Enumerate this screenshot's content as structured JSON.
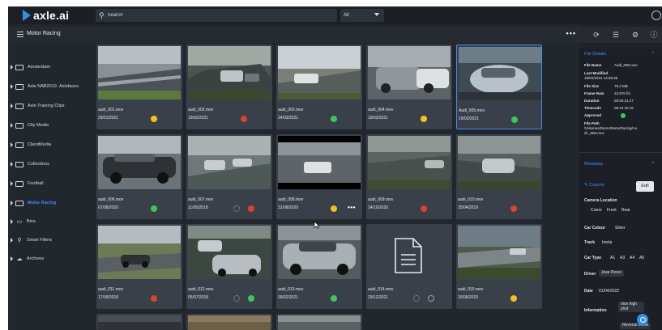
{
  "app": {
    "logo_text": "axle.ai"
  },
  "topbar": {
    "search_placeholder": "Search",
    "filter_value": "All"
  },
  "subbar": {
    "title": "Motor Racing",
    "more": "•••"
  },
  "sidebar": {
    "items": [
      {
        "label": "Amsterdam",
        "type": "folder"
      },
      {
        "label": "Axle NAB2019 -Axlefaces",
        "type": "folder"
      },
      {
        "label": "Axle Training Clips",
        "type": "folder"
      },
      {
        "label": "City Media",
        "type": "folder"
      },
      {
        "label": "ClientMedia",
        "type": "folder"
      },
      {
        "label": "Collections",
        "type": "folder"
      },
      {
        "label": "Football",
        "type": "folder"
      },
      {
        "label": "Motor Racing",
        "type": "folder",
        "active": true
      },
      {
        "label": "Bins",
        "type": "bins"
      },
      {
        "label": "Smart Filters",
        "type": "filters"
      },
      {
        "label": "Archives",
        "type": "archives"
      }
    ]
  },
  "colors": {
    "yellow": "#f2c21b",
    "red": "#d9432f",
    "green": "#3cc65a",
    "accent": "#3b8ff0"
  },
  "grid": {
    "cards": [
      {
        "name": "audi_001.mov",
        "date": "29/01/2021",
        "status": "yellow"
      },
      {
        "name": "audi_002.mov",
        "date": "19/02/2021",
        "status": "red"
      },
      {
        "name": "audi_003.mov",
        "date": "24/03/2021",
        "status": "green"
      },
      {
        "name": "audi_004.mov",
        "date": "19/02/2021",
        "status": "yellow"
      },
      {
        "name": "Audi_005.mov",
        "date": "19/02/2021",
        "status": "green",
        "selected": true
      },
      {
        "name": "audi_006.mov",
        "date": "07/08/2020",
        "status": "green"
      },
      {
        "name": "audi_007.mov",
        "date": "11/05/2018",
        "status": "red",
        "pending": true
      },
      {
        "name": "audi_008.mov",
        "date": "31/08/2020",
        "status": "yellow",
        "more": "•••"
      },
      {
        "name": "audi_009.mov",
        "date": "14/10/2020",
        "status": "red"
      },
      {
        "name": "audi_010.mov",
        "date": "25/04/2019",
        "status": "red"
      },
      {
        "name": "audi_011.mov",
        "date": "17/09/2018",
        "status": "red"
      },
      {
        "name": "audi_012.mov",
        "date": "05/07/2018",
        "status": "green",
        "pending": true
      },
      {
        "name": "audi_013.mov",
        "date": "09/02/2021",
        "status": "green"
      },
      {
        "name": "audi_014.mov",
        "date": "29/12/2021",
        "status": "none",
        "pending": true,
        "document": true
      },
      {
        "name": "audi_015.mov",
        "date": "16/06/2020",
        "status": "yellow"
      }
    ]
  },
  "file_details": {
    "heading": "File Details",
    "rows": [
      {
        "label": "File Name",
        "value": "Audi_005.mov"
      },
      {
        "label": "Last Modified",
        "value": ""
      },
      {
        "label": "",
        "value": "19/02/2021 14:59:38"
      },
      {
        "label": "File Size",
        "value": "79.2 MB"
      },
      {
        "label": "Frame Rate",
        "value": "23.976 f/s"
      },
      {
        "label": "Duration",
        "value": "00:00:21:17"
      },
      {
        "label": "Timecode",
        "value": "09:12:42:15"
      },
      {
        "label": "Approved",
        "value": ""
      },
      {
        "label": "File Path",
        "value": ""
      },
      {
        "label": "",
        "value": "/Volumes/Demo/MotorRacing/Au"
      },
      {
        "label": "",
        "value": "di-_005.mov"
      }
    ]
  },
  "metadata": {
    "heading": "Metadata",
    "custom_label": "Custom",
    "edit_label": "Edit",
    "camera_location_label": "Camera Location",
    "camera_location_options": [
      "Crane",
      "Front",
      "Rear"
    ],
    "car_colour_label": "Car Colour",
    "car_colour_value": "Silver",
    "track_label": "Track",
    "track_value": "Imola",
    "car_type_label": "Car Type",
    "car_type_values": [
      "A1",
      "A3",
      "A4",
      "A5"
    ],
    "driver_label": "Driver",
    "driver_value": "Jose Perez",
    "date_label": "Date",
    "date_value": "01/04/2022",
    "information_label": "Information",
    "information_value_1": "nice high",
    "information_value_2": "shot",
    "extra_chip": "Reverse throw"
  }
}
